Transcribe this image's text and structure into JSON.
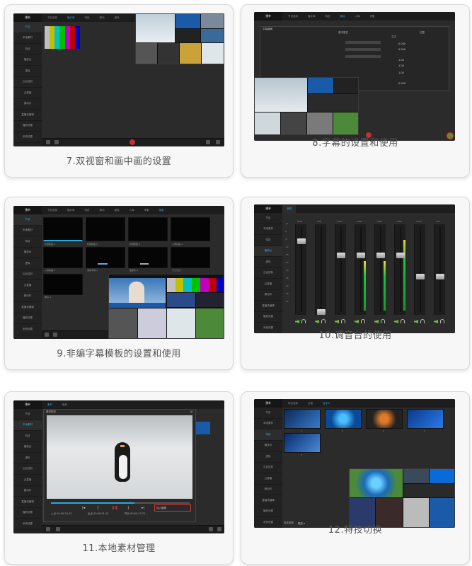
{
  "cards": [
    {
      "caption": "7.双视窗和画中画的设置"
    },
    {
      "caption": "8.字幕的设置和使用"
    },
    {
      "caption": "9.非编字幕模板的设置和使用"
    },
    {
      "caption": "10.调音台的使用"
    },
    {
      "caption": "11.本地素材管理"
    },
    {
      "caption": "12.特技切换"
    }
  ],
  "app": {
    "title": "播单",
    "sidebar": [
      "节目",
      "本地素材",
      "特技",
      "播放台",
      "虚拟",
      "云台控制",
      "云直播",
      "微动作",
      "直播流编辑",
      "播放设置",
      "系统设置"
    ],
    "tabs": [
      "节目选择",
      "播片库",
      "特技",
      "微动",
      "虚拟",
      "入库",
      "采集",
      "录制"
    ]
  },
  "s8": {
    "dialog_title": "字幕编辑",
    "headers": [
      "基本属性",
      "文字",
      "位置"
    ],
    "values": [
      "0.000",
      "0.000",
      "1.00",
      "1.00",
      "1.00",
      "0.000"
    ]
  },
  "s9": {
    "labels": [
      "标题模板-1",
      "标题模板-2",
      "标题模板-3",
      "入场动画-1",
      "入场动画-2",
      "滚动字幕-1",
      "底部条-1",
      "下三分之一",
      "角标-1"
    ]
  },
  "s10": {
    "tab": "音频",
    "channels": [
      "MAIN",
      "LINE",
      "CAM1",
      "CAM2",
      "CAM3",
      "CAM4",
      "CAM5",
      "OUT"
    ],
    "db_marks": [
      "+6",
      "0",
      "-6",
      "-12",
      "-18",
      "-24",
      "-30",
      "-36",
      "-42",
      "-48",
      "-54"
    ]
  },
  "s11": {
    "dialog_title": "素材预览",
    "tabs": [
      "素材",
      "播单"
    ],
    "in_point": "00:00:34:15",
    "out_point": "00:00:51:12",
    "duration": "00:00:12:22",
    "in_label": "入点",
    "out_label": "出点",
    "dur_label": "时长",
    "add_label": "加入播单"
  },
  "s12": {
    "tabs": [
      "特技选择",
      "过渡",
      "自定义"
    ],
    "bottom_label": "特技类型",
    "bottom_value": "推拉",
    "thumb_nums": [
      "1",
      "2",
      "3",
      "4",
      "5"
    ]
  },
  "colors": {
    "accent": "#29a8e0",
    "red": "#cc2b2b",
    "green": "#1fc23c"
  }
}
